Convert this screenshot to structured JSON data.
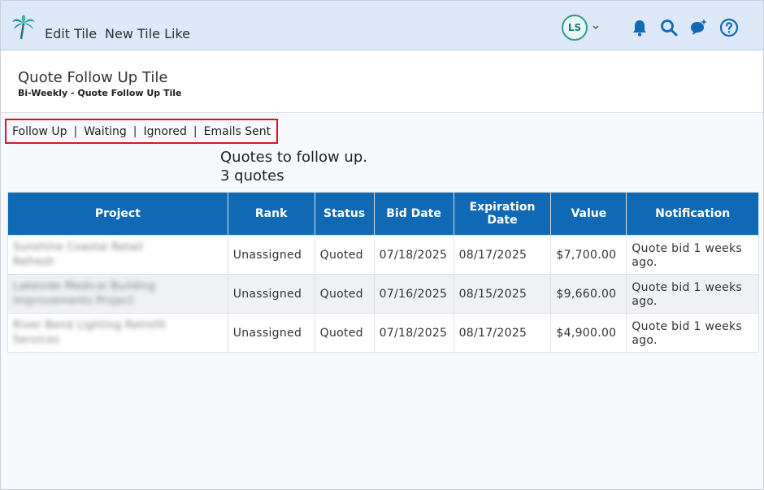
{
  "topbar": {
    "edit_tile": "Edit Tile",
    "new_tile_like": "New Tile Like",
    "avatar_initials": "LS"
  },
  "header": {
    "title": "Quote Follow Up Tile",
    "subtitle": "Bi-Weekly - Quote Follow Up Tile"
  },
  "tabs": {
    "items": [
      "Follow Up",
      "Waiting",
      "Ignored",
      "Emails Sent"
    ],
    "separator": "|"
  },
  "summary": {
    "title": "Quotes to follow up.",
    "count": "3 quotes"
  },
  "table": {
    "columns": [
      "Project",
      "Rank",
      "Status",
      "Bid Date",
      "Expiration Date",
      "Value",
      "Notification"
    ],
    "rows": [
      {
        "project": "Sunshine Coastal Retail Refresh",
        "rank": "Unassigned",
        "status": "Quoted",
        "bid_date": "07/18/2025",
        "expiration_date": "08/17/2025",
        "value": "$7,700.00",
        "notification": "Quote bid 1 weeks ago."
      },
      {
        "project": "Lakeside Medical Building Improvements Project",
        "rank": "Unassigned",
        "status": "Quoted",
        "bid_date": "07/16/2025",
        "expiration_date": "08/15/2025",
        "value": "$9,660.00",
        "notification": "Quote bid 1 weeks ago."
      },
      {
        "project": "River Bend Lighting Retrofit Services",
        "rank": "Unassigned",
        "status": "Quoted",
        "bid_date": "07/18/2025",
        "expiration_date": "08/17/2025",
        "value": "$4,900.00",
        "notification": "Quote bid 1 weeks ago."
      }
    ]
  },
  "colors": {
    "topbar_bg": "#dde9f8",
    "table_header": "#0f69b4",
    "tabs_highlight": "#e0141b",
    "accent_icon": "#0f69b4",
    "avatar_ring": "#2a9d8f"
  },
  "icons": [
    "palm-tree-logo",
    "chevron-down-icon",
    "bell-icon",
    "search-icon",
    "ai-chat-icon",
    "help-icon"
  ]
}
